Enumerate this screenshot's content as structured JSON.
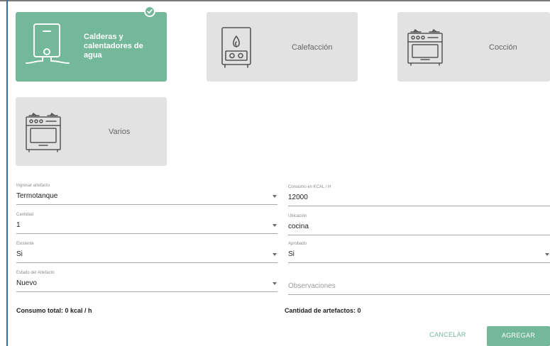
{
  "categories": [
    {
      "label": "Calderas y calentadores de agua",
      "icon": "water-heater-icon",
      "selected": true
    },
    {
      "label": "Calefacción",
      "icon": "gas-heater-icon",
      "selected": false
    },
    {
      "label": "Cocción",
      "icon": "stove-icon",
      "selected": false
    },
    {
      "label": "Varios",
      "icon": "stove-icon",
      "selected": false
    }
  ],
  "form": {
    "artefacto": {
      "label": "Ingresar artefacto",
      "value": "Termotanque"
    },
    "consumo": {
      "label": "Consumo en KCAL / H",
      "value": "12000"
    },
    "cantidad": {
      "label": "Cantidad",
      "value": "1"
    },
    "ubicacion": {
      "label": "Ubicación",
      "value": "cocina"
    },
    "existente": {
      "label": "Existente",
      "value": "Si"
    },
    "aprobado": {
      "label": "Aprobado",
      "value": "Si"
    },
    "estado": {
      "label": "Estado del Artefacto",
      "value": "Nuevo"
    },
    "observaciones": {
      "placeholder": "Observaciones"
    }
  },
  "totals": {
    "consumo_total": "Consumo total: 0 kcal / h",
    "cantidad_artefactos": "Cantidad de artefactos: 0"
  },
  "actions": {
    "cancel_label": "CANCELAR",
    "add_label": "AGREGAR"
  },
  "colors": {
    "accent": "#74b89a",
    "card_bg": "#e2e2e2",
    "frame_left": "#2b6fb0"
  }
}
